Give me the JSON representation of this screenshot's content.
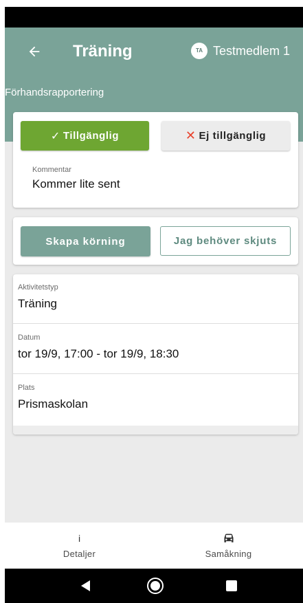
{
  "header": {
    "title": "Träning",
    "subtitle": "Förhandsrapportering",
    "back_icon": "arrow-left-icon",
    "user": {
      "initials": "TA",
      "name": "Testmedlem 1"
    },
    "color": "#7aa398"
  },
  "availability": {
    "available_label": "Tillgänglig",
    "available_icon": "✓",
    "unavailable_label": "Ej tillgänglig",
    "unavailable_icon": "✕",
    "available_color": "#6ea632",
    "unavailable_icon_color": "#e8432d",
    "comment_label": "Kommentar",
    "comment_value": "Kommer lite sent"
  },
  "carpool": {
    "create_ride_label": "Skapa körning",
    "need_ride_label": "Jag behöver skjuts"
  },
  "details": {
    "rows": [
      {
        "label": "Aktivitetstyp",
        "value": "Träning"
      },
      {
        "label": "Datum",
        "value": "tor 19/9, 17:00 - tor 19/9, 18:30"
      },
      {
        "label": "Plats",
        "value": "Prismaskolan"
      }
    ]
  },
  "bottom_nav": {
    "items": [
      {
        "label": "Detaljer",
        "icon": "info-icon",
        "glyph": "i"
      },
      {
        "label": "Samåkning",
        "icon": "car-icon"
      }
    ]
  },
  "system_nav": {
    "buttons": [
      "back-icon",
      "home-icon",
      "recent-apps-icon"
    ]
  }
}
